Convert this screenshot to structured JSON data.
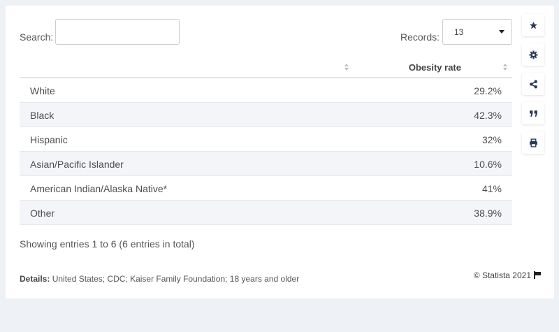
{
  "search": {
    "label": "Search:",
    "value": "",
    "placeholder": ""
  },
  "records": {
    "label": "Records:",
    "selected": "13"
  },
  "table": {
    "columns": [
      "",
      "Obesity rate"
    ],
    "rows": [
      {
        "label": "White",
        "value": "29.2%"
      },
      {
        "label": "Black",
        "value": "42.3%"
      },
      {
        "label": "Hispanic",
        "value": "32%"
      },
      {
        "label": "Asian/Pacific Islander",
        "value": "10.6%"
      },
      {
        "label": "American Indian/Alaska Native*",
        "value": "41%"
      },
      {
        "label": "Other",
        "value": "38.9%"
      }
    ]
  },
  "footer": {
    "showing": "Showing entries 1 to 6 (6 entries in total)",
    "details_label": "Details:",
    "details_text": "United States; CDC; Kaiser Family Foundation; 18 years and older",
    "copyright": "© Statista 2021"
  },
  "sidebar_buttons": [
    "star-icon",
    "gear-icon",
    "share-icon",
    "quote-icon",
    "print-icon"
  ],
  "colors": {
    "icon": "#2b3a55",
    "row_alt": "#f3f5f8"
  }
}
